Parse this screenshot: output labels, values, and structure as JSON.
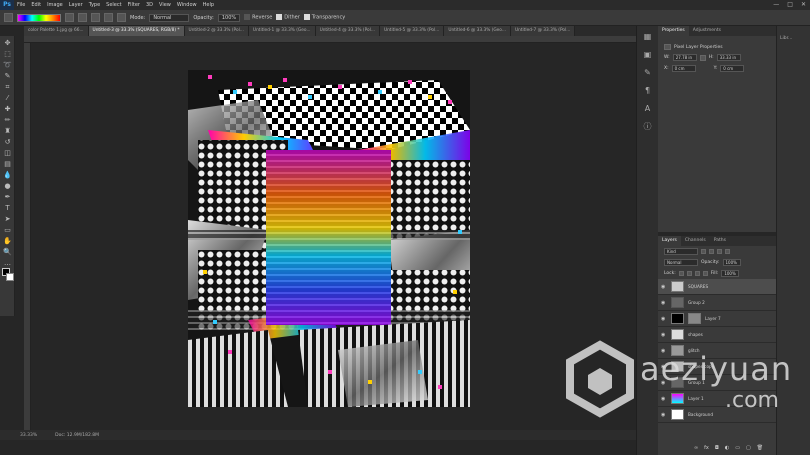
{
  "app": {
    "logo": "Ps"
  },
  "menu": [
    "File",
    "Edit",
    "Image",
    "Layer",
    "Type",
    "Select",
    "Filter",
    "3D",
    "View",
    "Window",
    "Help"
  ],
  "window_controls": [
    "—",
    "□",
    "✕"
  ],
  "options_bar": {
    "mode_label": "Mode:",
    "mode_value": "Normal",
    "opacity_label": "Opacity:",
    "opacity_value": "100%",
    "reverse": "Reverse",
    "dither": "Dither",
    "transparency": "Transparency"
  },
  "tabs": [
    {
      "label": "color Palette 1.jpg @ 66...",
      "active": false
    },
    {
      "label": "Untitled-3 @ 33.3% (SQUARES, RGB/8) *",
      "active": true
    },
    {
      "label": "Untitled-2 @ 33.3% (Pol...",
      "active": false
    },
    {
      "label": "Untitled-1 @ 33.3% (Geo...",
      "active": false
    },
    {
      "label": "Untitled-4 @ 33.3% (Pol...",
      "active": false
    },
    {
      "label": "Untitled-5 @ 33.3% (Pol...",
      "active": false
    },
    {
      "label": "Untitled-6 @ 33.3% (Geo...",
      "active": false
    },
    {
      "label": "Untitled-7 @ 33.3% (Pol...",
      "active": false
    }
  ],
  "status": {
    "zoom": "33.33%",
    "doc": "Doc: 12.9M/182.8M"
  },
  "properties": {
    "tabs": [
      "Properties",
      "Adjustments"
    ],
    "title": "Pixel Layer Properties",
    "w_label": "W:",
    "w_value": "27.78 in",
    "h_label": "H:",
    "h_value": "33.33 in",
    "x_label": "X:",
    "x_value": "0 cm",
    "y_label": "Y:",
    "y_value": "0 cm",
    "lib_label": "Libr..."
  },
  "layers": {
    "tabs": [
      "Layers",
      "Channels",
      "Paths"
    ],
    "kind": "Kind",
    "blend": "Normal",
    "opacity_label": "Opacity:",
    "opacity_value": "100%",
    "lock_label": "Lock:",
    "fill_label": "Fill:",
    "fill_value": "100%",
    "items": [
      {
        "name": "SQUARES",
        "selected": true
      },
      {
        "name": "Group 2",
        "selected": false
      },
      {
        "name": "Layer 7",
        "selected": false
      },
      {
        "name": "shapes",
        "selected": false
      },
      {
        "name": "glitch",
        "selected": false
      },
      {
        "name": "shapes copy",
        "selected": false
      },
      {
        "name": "Group 1",
        "selected": false
      },
      {
        "name": "Layer 1",
        "selected": false
      },
      {
        "name": "Background",
        "selected": false
      }
    ],
    "footer_icons": [
      "link-icon",
      "fx-icon",
      "mask-icon",
      "adjustment-icon",
      "folder-icon",
      "new-layer-icon",
      "trash-icon"
    ]
  },
  "watermark": {
    "line1": "aeziyuan",
    "line2": ".com"
  }
}
